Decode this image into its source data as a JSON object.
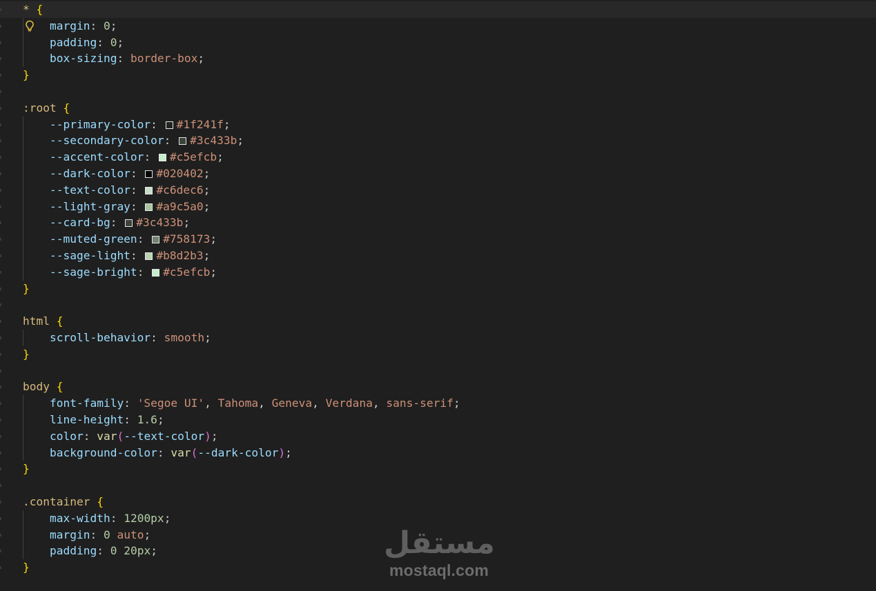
{
  "editor": {
    "language": "css",
    "theme": {
      "background": "#1f1f1f",
      "current_line": "#282828",
      "selector": "#d7ba7d",
      "brace": "#ffd700",
      "paren": "#da70d6",
      "property": "#9cdcfe",
      "number": "#b5cea8",
      "value": "#ce9178",
      "function": "#dcdcaa"
    },
    "lightbulb_icon": "lightbulb-icon",
    "lines": [
      {
        "indent": false,
        "current": true,
        "tokens": [
          {
            "t": "sel",
            "v": "* "
          },
          {
            "t": "brace",
            "v": "{"
          }
        ]
      },
      {
        "indent": true,
        "bulb": true,
        "tokens": [
          {
            "t": "prop",
            "v": "margin"
          },
          {
            "t": "punc",
            "v": ": "
          },
          {
            "t": "num",
            "v": "0"
          },
          {
            "t": "punc",
            "v": ";"
          }
        ]
      },
      {
        "indent": true,
        "tokens": [
          {
            "t": "prop",
            "v": "padding"
          },
          {
            "t": "punc",
            "v": ": "
          },
          {
            "t": "num",
            "v": "0"
          },
          {
            "t": "punc",
            "v": ";"
          }
        ]
      },
      {
        "indent": true,
        "tokens": [
          {
            "t": "prop",
            "v": "box-sizing"
          },
          {
            "t": "punc",
            "v": ": "
          },
          {
            "t": "val",
            "v": "border-box"
          },
          {
            "t": "punc",
            "v": ";"
          }
        ]
      },
      {
        "indent": false,
        "tokens": [
          {
            "t": "brace",
            "v": "}"
          }
        ]
      },
      {
        "indent": false,
        "tokens": []
      },
      {
        "indent": false,
        "tokens": [
          {
            "t": "sel",
            "v": ":root "
          },
          {
            "t": "brace",
            "v": "{"
          }
        ]
      },
      {
        "indent": true,
        "tokens": [
          {
            "t": "prop",
            "v": "--primary-color"
          },
          {
            "t": "punc",
            "v": ": "
          },
          {
            "t": "swatch",
            "v": "#1f241f"
          },
          {
            "t": "val",
            "v": "#1f241f"
          },
          {
            "t": "punc",
            "v": ";"
          }
        ]
      },
      {
        "indent": true,
        "tokens": [
          {
            "t": "prop",
            "v": "--secondary-color"
          },
          {
            "t": "punc",
            "v": ": "
          },
          {
            "t": "swatch",
            "v": "#3c433b"
          },
          {
            "t": "val",
            "v": "#3c433b"
          },
          {
            "t": "punc",
            "v": ";"
          }
        ]
      },
      {
        "indent": true,
        "tokens": [
          {
            "t": "prop",
            "v": "--accent-color"
          },
          {
            "t": "punc",
            "v": ": "
          },
          {
            "t": "swatch",
            "v": "#c5efcb"
          },
          {
            "t": "val",
            "v": "#c5efcb"
          },
          {
            "t": "punc",
            "v": ";"
          }
        ]
      },
      {
        "indent": true,
        "tokens": [
          {
            "t": "prop",
            "v": "--dark-color"
          },
          {
            "t": "punc",
            "v": ": "
          },
          {
            "t": "swatch",
            "v": "#020402"
          },
          {
            "t": "val",
            "v": "#020402"
          },
          {
            "t": "punc",
            "v": ";"
          }
        ]
      },
      {
        "indent": true,
        "tokens": [
          {
            "t": "prop",
            "v": "--text-color"
          },
          {
            "t": "punc",
            "v": ": "
          },
          {
            "t": "swatch",
            "v": "#c6dec6"
          },
          {
            "t": "val",
            "v": "#c6dec6"
          },
          {
            "t": "punc",
            "v": ";"
          }
        ]
      },
      {
        "indent": true,
        "tokens": [
          {
            "t": "prop",
            "v": "--light-gray"
          },
          {
            "t": "punc",
            "v": ": "
          },
          {
            "t": "swatch",
            "v": "#a9c5a0"
          },
          {
            "t": "val",
            "v": "#a9c5a0"
          },
          {
            "t": "punc",
            "v": ";"
          }
        ]
      },
      {
        "indent": true,
        "tokens": [
          {
            "t": "prop",
            "v": "--card-bg"
          },
          {
            "t": "punc",
            "v": ": "
          },
          {
            "t": "swatch",
            "v": "#3c433b"
          },
          {
            "t": "val",
            "v": "#3c433b"
          },
          {
            "t": "punc",
            "v": ";"
          }
        ]
      },
      {
        "indent": true,
        "tokens": [
          {
            "t": "prop",
            "v": "--muted-green"
          },
          {
            "t": "punc",
            "v": ": "
          },
          {
            "t": "swatch",
            "v": "#758173"
          },
          {
            "t": "val",
            "v": "#758173"
          },
          {
            "t": "punc",
            "v": ";"
          }
        ]
      },
      {
        "indent": true,
        "tokens": [
          {
            "t": "prop",
            "v": "--sage-light"
          },
          {
            "t": "punc",
            "v": ": "
          },
          {
            "t": "swatch",
            "v": "#b8d2b3"
          },
          {
            "t": "val",
            "v": "#b8d2b3"
          },
          {
            "t": "punc",
            "v": ";"
          }
        ]
      },
      {
        "indent": true,
        "tokens": [
          {
            "t": "prop",
            "v": "--sage-bright"
          },
          {
            "t": "punc",
            "v": ": "
          },
          {
            "t": "swatch",
            "v": "#c5efcb"
          },
          {
            "t": "val",
            "v": "#c5efcb"
          },
          {
            "t": "punc",
            "v": ";"
          }
        ]
      },
      {
        "indent": false,
        "tokens": [
          {
            "t": "brace",
            "v": "}"
          }
        ]
      },
      {
        "indent": false,
        "tokens": []
      },
      {
        "indent": false,
        "tokens": [
          {
            "t": "sel",
            "v": "html "
          },
          {
            "t": "brace",
            "v": "{"
          }
        ]
      },
      {
        "indent": true,
        "tokens": [
          {
            "t": "prop",
            "v": "scroll-behavior"
          },
          {
            "t": "punc",
            "v": ": "
          },
          {
            "t": "val",
            "v": "smooth"
          },
          {
            "t": "punc",
            "v": ";"
          }
        ]
      },
      {
        "indent": false,
        "tokens": [
          {
            "t": "brace",
            "v": "}"
          }
        ]
      },
      {
        "indent": false,
        "tokens": []
      },
      {
        "indent": false,
        "tokens": [
          {
            "t": "sel",
            "v": "body "
          },
          {
            "t": "brace",
            "v": "{"
          }
        ]
      },
      {
        "indent": true,
        "tokens": [
          {
            "t": "prop",
            "v": "font-family"
          },
          {
            "t": "punc",
            "v": ": "
          },
          {
            "t": "str",
            "v": "'Segoe UI'"
          },
          {
            "t": "punc",
            "v": ", "
          },
          {
            "t": "val",
            "v": "Tahoma"
          },
          {
            "t": "punc",
            "v": ", "
          },
          {
            "t": "val",
            "v": "Geneva"
          },
          {
            "t": "punc",
            "v": ", "
          },
          {
            "t": "val",
            "v": "Verdana"
          },
          {
            "t": "punc",
            "v": ", "
          },
          {
            "t": "val",
            "v": "sans-serif"
          },
          {
            "t": "punc",
            "v": ";"
          }
        ]
      },
      {
        "indent": true,
        "tokens": [
          {
            "t": "prop",
            "v": "line-height"
          },
          {
            "t": "punc",
            "v": ": "
          },
          {
            "t": "num",
            "v": "1.6"
          },
          {
            "t": "punc",
            "v": ";"
          }
        ]
      },
      {
        "indent": true,
        "tokens": [
          {
            "t": "prop",
            "v": "color"
          },
          {
            "t": "punc",
            "v": ": "
          },
          {
            "t": "fn",
            "v": "var"
          },
          {
            "t": "paren",
            "v": "("
          },
          {
            "t": "var",
            "v": "--text-color"
          },
          {
            "t": "paren",
            "v": ")"
          },
          {
            "t": "punc",
            "v": ";"
          }
        ]
      },
      {
        "indent": true,
        "tokens": [
          {
            "t": "prop",
            "v": "background-color"
          },
          {
            "t": "punc",
            "v": ": "
          },
          {
            "t": "fn",
            "v": "var"
          },
          {
            "t": "paren",
            "v": "("
          },
          {
            "t": "var",
            "v": "--dark-color"
          },
          {
            "t": "paren",
            "v": ")"
          },
          {
            "t": "punc",
            "v": ";"
          }
        ]
      },
      {
        "indent": false,
        "tokens": [
          {
            "t": "brace",
            "v": "}"
          }
        ]
      },
      {
        "indent": false,
        "tokens": []
      },
      {
        "indent": false,
        "tokens": [
          {
            "t": "sel",
            "v": ".container "
          },
          {
            "t": "brace",
            "v": "{"
          }
        ]
      },
      {
        "indent": true,
        "tokens": [
          {
            "t": "prop",
            "v": "max-width"
          },
          {
            "t": "punc",
            "v": ": "
          },
          {
            "t": "num",
            "v": "1200px"
          },
          {
            "t": "punc",
            "v": ";"
          }
        ]
      },
      {
        "indent": true,
        "tokens": [
          {
            "t": "prop",
            "v": "margin"
          },
          {
            "t": "punc",
            "v": ": "
          },
          {
            "t": "num",
            "v": "0"
          },
          {
            "t": "punc",
            "v": " "
          },
          {
            "t": "val",
            "v": "auto"
          },
          {
            "t": "punc",
            "v": ";"
          }
        ]
      },
      {
        "indent": true,
        "tokens": [
          {
            "t": "prop",
            "v": "padding"
          },
          {
            "t": "punc",
            "v": ": "
          },
          {
            "t": "num",
            "v": "0"
          },
          {
            "t": "punc",
            "v": " "
          },
          {
            "t": "num",
            "v": "20px"
          },
          {
            "t": "punc",
            "v": ";"
          }
        ]
      },
      {
        "indent": false,
        "tokens": [
          {
            "t": "brace",
            "v": "}"
          }
        ]
      }
    ]
  },
  "watermark": {
    "arabic": "مستقل",
    "latin": "mostaql.com"
  }
}
